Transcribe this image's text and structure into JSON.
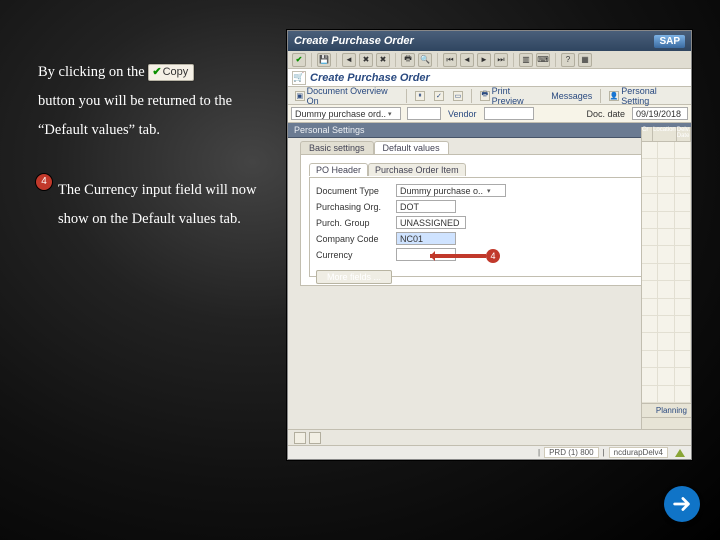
{
  "left": {
    "para1a": "By clicking on the",
    "inline_btn": "Copy",
    "para1b": "button you will be returned to the “Default values” tab.",
    "step": "4",
    "para2": "The Currency input field will now show on the Default values tab."
  },
  "sap": {
    "title": "Create Purchase Order",
    "logo": "SAP",
    "subtitle": "Create Purchase Order",
    "tb2": {
      "docov": "Document Overview On",
      "pp": "Print Preview",
      "msg": "Messages",
      "ps": "Personal Setting"
    },
    "hdr": {
      "combo": "Dummy purchase ord..",
      "combo2": "",
      "vendor_lbl": "Vendor",
      "vendor_val": "",
      "docdate_lbl": "Doc. date",
      "docdate_val": "09/19/2018"
    },
    "ps_bar": "Personal Settings",
    "tabs": {
      "basic": "Basic settings",
      "default": "Default values"
    },
    "potabs": {
      "hdr": "PO Header",
      "item": "Purchase Order Item"
    },
    "fields": {
      "doctype_lbl": "Document Type",
      "doctype_val": "Dummy purchase o..",
      "porg_lbl": "Purchasing Org.",
      "porg_val": "DOT",
      "pgrp_lbl": "Purch. Group",
      "pgrp_val": "UNASSIGNED",
      "ccode_lbl": "Company Code",
      "ccode_val": "NC01",
      "curr_lbl": "Currency",
      "curr_val": "",
      "more": "More fields ..."
    },
    "callout4": "4",
    "sp_cols": {
      "a": "Cr",
      "b": "Location",
      "c": "Delv. Date"
    },
    "planning": "Planning",
    "footer": {
      "pro": "PRD (1) 800",
      "client": "ncdurapDelv4",
      "sep": "|"
    }
  }
}
